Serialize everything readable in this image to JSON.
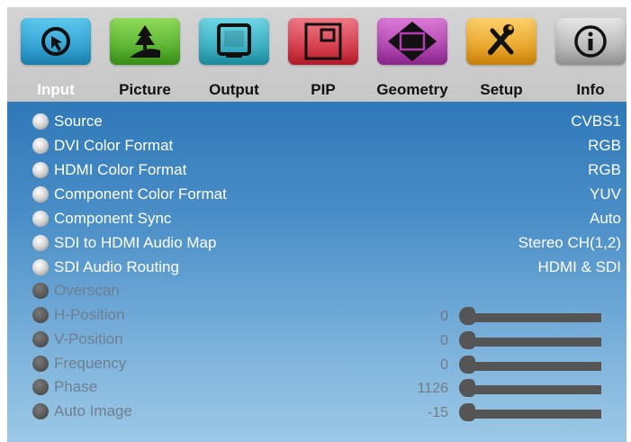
{
  "tabs": [
    {
      "label": "Input",
      "icon": "input-icon",
      "color": "#2aa6d6",
      "active": true
    },
    {
      "label": "Picture",
      "icon": "picture-icon",
      "color": "#5cbf2a",
      "active": false
    },
    {
      "label": "Output",
      "icon": "output-icon",
      "color": "#28b4c8",
      "active": false
    },
    {
      "label": "PIP",
      "icon": "pip-icon",
      "color": "#e03a48",
      "active": false
    },
    {
      "label": "Geometry",
      "icon": "geometry-icon",
      "color": "#b43cb4",
      "active": false
    },
    {
      "label": "Setup",
      "icon": "setup-icon",
      "color": "#f0a81e",
      "active": false
    },
    {
      "label": "Info",
      "icon": "info-icon",
      "color": "#b8b8b8",
      "active": false
    }
  ],
  "items": [
    {
      "label": "Source",
      "value": "CVBS1"
    },
    {
      "label": "DVI Color Format",
      "value": "RGB"
    },
    {
      "label": "HDMI Color Format",
      "value": "RGB"
    },
    {
      "label": "Component Color Format",
      "value": "YUV"
    },
    {
      "label": "Component Sync",
      "value": "Auto"
    },
    {
      "label": "SDI to HDMI Audio Map",
      "value": "Stereo CH(1,2)"
    },
    {
      "label": "SDI Audio Routing",
      "value": "HDMI & SDI"
    }
  ],
  "disabled_items": [
    {
      "label": "Overscan"
    },
    {
      "label": "H-Position",
      "value": "0"
    },
    {
      "label": "V-Position",
      "value": "0"
    },
    {
      "label": "Frequency",
      "value": "0"
    },
    {
      "label": "Phase",
      "value": "1126"
    },
    {
      "label": "Auto Image",
      "value": "-15"
    }
  ],
  "colors": {
    "menu_top": "#2f78b8",
    "menu_bottom": "#9cc8e6",
    "tabbar": "#c8c8c8",
    "disabled_text": "#6f7f8e"
  }
}
